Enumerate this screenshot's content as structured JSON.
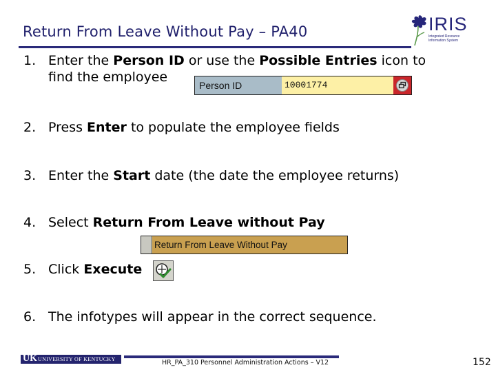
{
  "header": {
    "title": "Return From Leave Without Pay – PA40",
    "logo": {
      "name": "IRIS",
      "subtitle_line1": "Integrated Resource",
      "subtitle_line2": "Information System"
    }
  },
  "steps": [
    {
      "number": "1.",
      "parts": [
        {
          "text": "Enter the ",
          "bold": false
        },
        {
          "text": "Person ID",
          "bold": true
        },
        {
          "text": " or use the ",
          "bold": false
        },
        {
          "text": "Possible Entries",
          "bold": true
        },
        {
          "text": " icon to",
          "bold": false
        }
      ],
      "continuation": "find the employee"
    },
    {
      "number": "2.",
      "parts": [
        {
          "text": "Press ",
          "bold": false
        },
        {
          "text": "Enter",
          "bold": true
        },
        {
          "text": " to populate the employee fields",
          "bold": false
        }
      ]
    },
    {
      "number": "3.",
      "parts": [
        {
          "text": "Enter the ",
          "bold": false
        },
        {
          "text": "Start",
          "bold": true
        },
        {
          "text": " date (the date the employee returns)",
          "bold": false
        }
      ]
    },
    {
      "number": "4.",
      "parts": [
        {
          "text": "Select ",
          "bold": false
        },
        {
          "text": "Return From Leave without Pay",
          "bold": true
        }
      ]
    },
    {
      "number": "5.",
      "parts": [
        {
          "text": "Click ",
          "bold": false
        },
        {
          "text": "Execute",
          "bold": true
        }
      ]
    },
    {
      "number": "6.",
      "parts": [
        {
          "text": "The infotypes will appear in the correct sequence.",
          "bold": false
        }
      ]
    }
  ],
  "person_id_field": {
    "label": "Person ID",
    "value": "10001774",
    "possible_entries_icon": "possible-entries-icon"
  },
  "action_selection": {
    "label": "Return From Leave Without Pay"
  },
  "execute_button": {
    "icon": "execute-clock-check-icon"
  },
  "footer": {
    "university": "UNIVERSITY OF KENTUCKY",
    "uk_mark": "UK",
    "course": "HR_PA_310 Personnel Administration Actions – V12",
    "page_number": "152"
  },
  "colors": {
    "title": "#1f1f6b",
    "rule": "#2a2a7a",
    "label_bg": "#a9bcc8",
    "input_bg": "#fdf0a6",
    "f4_highlight": "#c9262b",
    "select_bg": "#c9a050"
  }
}
